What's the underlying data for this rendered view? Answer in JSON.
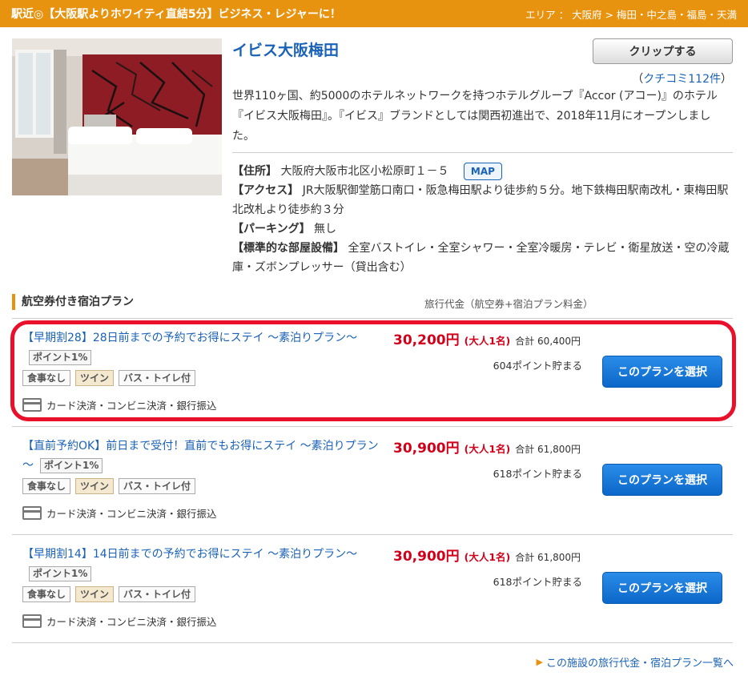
{
  "banner": {
    "title": "駅近◎【大阪駅よりホワイティ直結5分】ビジネス・レジャーに！",
    "area": "エリア ： 大阪府 > 梅田・中之島・福島・天満"
  },
  "hotel": {
    "name": "イビス大阪梅田",
    "clip_label": "クリップする",
    "review_prefix": "（",
    "review_label": "クチコミ112件",
    "review_suffix": "）",
    "description": "世界110ヶ国、約5000のホテルネットワークを持つホテルグループ『Accor (アコー)』のホテル『イビス大阪梅田』。『イビス』ブランドとしては関西初進出で、2018年11月にオープンしました。",
    "address_label": "【住所】",
    "address_value": "大阪府大阪市北区小松原町１－５",
    "map_label": "MAP",
    "access_label": "【アクセス】",
    "access_value": "JR大阪駅御堂筋口南口・阪急梅田駅より徒歩約５分。地下鉄梅田駅南改札・東梅田駅北改札より徒歩約３分",
    "parking_label": "【パーキング】",
    "parking_value": "無し",
    "facilities_label": "【標準的な部屋設備】",
    "facilities_value": "全室バストイレ・全室シャワー・全室冷暖房・テレビ・衛星放送・空の冷蔵庫・ズボンプレッサー（貸出含む）"
  },
  "plans_section": {
    "title": "航空券付き宿泊プラン",
    "price_header": "旅行代金（航空券+宿泊プラン料金）"
  },
  "plans": [
    {
      "title": "【早期割28】28日前までの予約でお得にステイ ～素泊りプラン～",
      "point_badge": "ポイント1%",
      "tags": [
        "食事なし",
        "ツイン",
        "バス・トイレ付"
      ],
      "payment": "カード決済・コンビニ決済・銀行振込",
      "price": "30,200円",
      "persons": "(大人1名)",
      "total": "合計 60,400円",
      "points": "604ポイント貯まる",
      "select_label": "このプランを選択"
    },
    {
      "title": "【直前予約OK】前日まで受付！直前でもお得にステイ ～素泊りプラン～",
      "point_badge": "ポイント1%",
      "tags": [
        "食事なし",
        "ツイン",
        "バス・トイレ付"
      ],
      "payment": "カード決済・コンビニ決済・銀行振込",
      "price": "30,900円",
      "persons": "(大人1名)",
      "total": "合計 61,800円",
      "points": "618ポイント貯まる",
      "select_label": "このプランを選択"
    },
    {
      "title": "【早期割14】14日前までの予約でお得にステイ ～素泊りプラン～",
      "point_badge": "ポイント1%",
      "tags": [
        "食事なし",
        "ツイン",
        "バス・トイレ付"
      ],
      "payment": "カード決済・コンビニ決済・銀行振込",
      "price": "30,900円",
      "persons": "(大人1名)",
      "total": "合計 61,800円",
      "points": "618ポイント貯まる",
      "select_label": "このプランを選択"
    }
  ],
  "footer_link": "この施設の旅行代金・宿泊プラン一覧へ",
  "colors": {
    "banner": "#e8930f",
    "link": "#1a62b8",
    "price": "#d0021b",
    "button": "#0b67c9",
    "highlight": "#e8102a"
  },
  "icons": {
    "card": "credit-card-icon",
    "footer": "triangle-right-icon"
  }
}
